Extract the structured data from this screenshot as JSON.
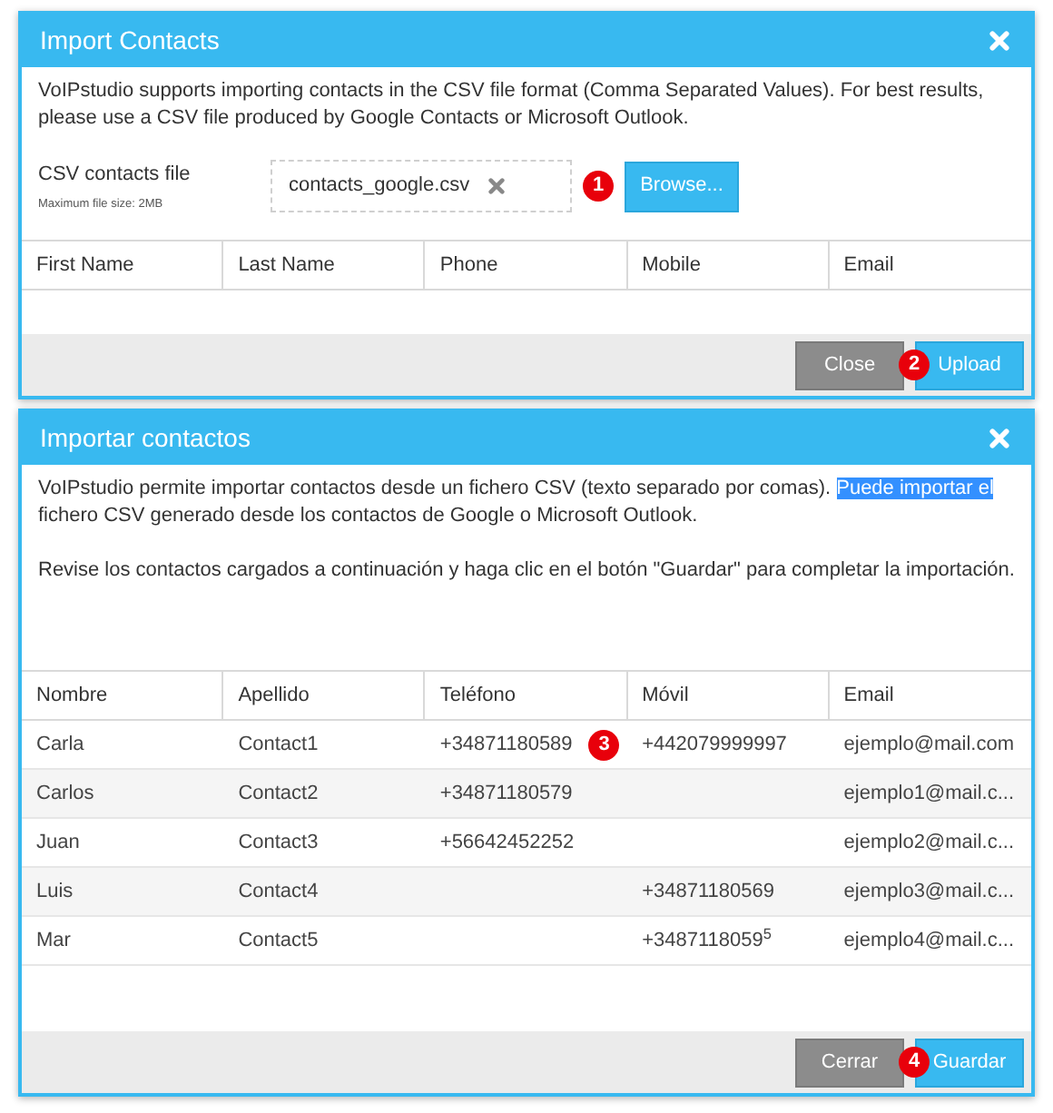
{
  "dialogs": [
    {
      "title": "Import Contacts",
      "description": {
        "text": "VoIPstudio supports importing contacts in the CSV file format (Comma Separated Values). For best results, please use a CSV file produced by Google Contacts or Microsoft Outlook."
      },
      "file_field": {
        "label": "CSV contacts file",
        "hint": "Maximum file size: 2MB",
        "value": "contacts_google.csv",
        "callout": "1",
        "browse": "Browse..."
      },
      "columns": [
        "First Name",
        "Last Name",
        "Phone",
        "Mobile",
        "Email"
      ],
      "buttons": [
        {
          "label": "Close",
          "kind": "secondary"
        },
        {
          "label": "Upload",
          "kind": "primary",
          "callout": "2"
        }
      ]
    },
    {
      "title": "Importar contactos",
      "description": {
        "text": "VoIPstudio permite importar contactos desde un fichero CSV (texto separado por comas). ",
        "highlighted": "Puede importar el",
        "text_after": " fichero CSV generado desde los contactos de Google o Microsoft Outlook.",
        "note": "Revise los contactos cargados a continuación y haga clic en el botón \"Guardar\" para completar la importación."
      },
      "columns": [
        "Nombre",
        "Apellido",
        "Teléfono",
        "Móvil",
        "Email"
      ],
      "rows": [
        {
          "cells": [
            "Carla",
            "Contact1",
            "+34871180589",
            "+442079999997",
            "ejemplo@mail.com"
          ],
          "callout": "3"
        },
        {
          "cells": [
            "Carlos",
            "Contact2",
            "+34871180579",
            "",
            "ejemplo1@mail.c..."
          ]
        },
        {
          "cells": [
            "Juan",
            "Contact3",
            "+56642452252",
            "",
            "ejemplo2@mail.c..."
          ]
        },
        {
          "cells": [
            "Luis",
            "Contact4",
            "",
            "+34871180569",
            "ejemplo3@mail.c..."
          ]
        },
        {
          "cells": [
            "Mar",
            "Contact5",
            "",
            "+3487118059$^{5}$",
            "ejemplo4@mail.c..."
          ]
        }
      ],
      "buttons": [
        {
          "label": "Cerrar",
          "kind": "secondary"
        },
        {
          "label": "Guardar",
          "kind": "primary",
          "callout": "4"
        }
      ]
    }
  ]
}
